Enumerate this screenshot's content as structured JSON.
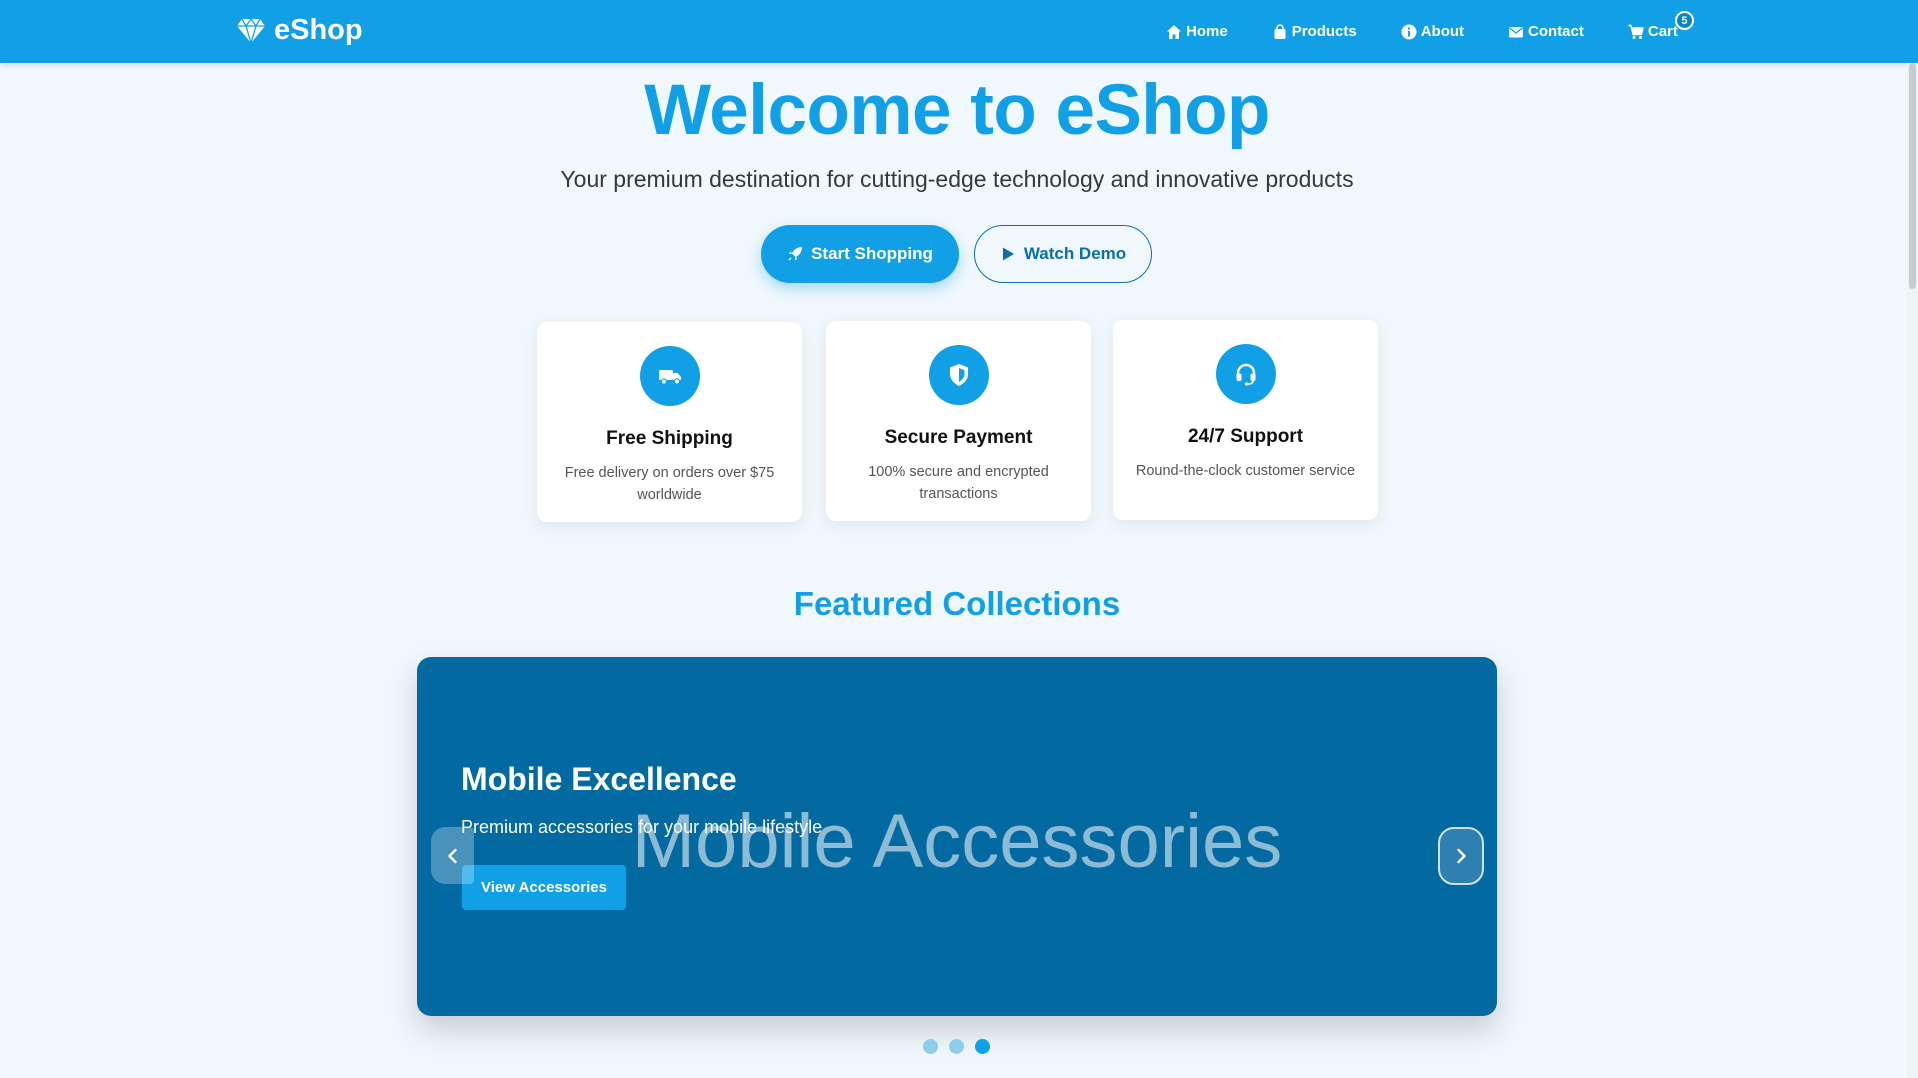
{
  "brand": {
    "name": "eShop",
    "icon": "diamond-icon"
  },
  "nav": {
    "items": [
      {
        "label": "Home",
        "icon": "home-icon"
      },
      {
        "label": "Products",
        "icon": "bag-icon"
      },
      {
        "label": "About",
        "icon": "info-icon"
      },
      {
        "label": "Contact",
        "icon": "envelope-icon"
      },
      {
        "label": "Cart",
        "icon": "cart-icon"
      }
    ],
    "cart_count": "5"
  },
  "hero": {
    "title": "Welcome to eShop",
    "subtitle": "Your premium destination for cutting-edge technology and innovative products",
    "primary_button": "Start Shopping",
    "secondary_button": "Watch Demo"
  },
  "features": [
    {
      "title": "Free Shipping",
      "desc": "Free delivery on orders over $75 worldwide",
      "icon": "truck-icon"
    },
    {
      "title": "Secure Payment",
      "desc": "100% secure and encrypted transactions",
      "icon": "shield-icon"
    },
    {
      "title": "24/7 Support",
      "desc": "Round-the-clock customer service",
      "icon": "headset-icon"
    }
  ],
  "featured": {
    "title": "Featured Collections",
    "slide": {
      "watermark": "Mobile Accessories",
      "title": "Mobile Excellence",
      "subtitle": "Premium accessories for your mobile lifestyle",
      "button": "View Accessories"
    },
    "active_slide": 3,
    "slide_count": 3
  },
  "colors": {
    "primary": "#11a0e6",
    "carousel_bg": "#0369a1",
    "page_bg": "#f1f8fd"
  }
}
